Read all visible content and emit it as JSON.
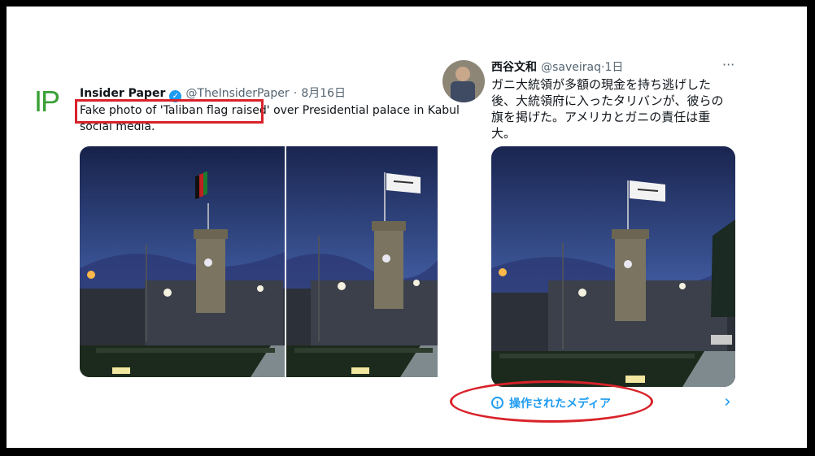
{
  "left_tweet": {
    "avatar_text": "IP",
    "author_name": "Insider Paper",
    "handle": "@TheInsiderPaper",
    "separator": "·",
    "date": "8月16日",
    "text_line1_highlight": "Fake photo of 'Taliban flag raised'",
    "text_line1_rest": " over Presidential palace in Kabul",
    "text_line2": "social media."
  },
  "right_tweet": {
    "author_name": "西谷文和",
    "handle": "@saveiraq",
    "separator": "·",
    "time": "1日",
    "more_label": "···",
    "text_lines": [
      "ガニ大統領が多額の現金を持ち逃げした",
      "後、大統領府に入ったタリバンが、彼らの",
      "旗を掲げた。アメリカとガニの責任は重",
      "大。"
    ],
    "manipulated_label": "操作されたメディア",
    "chevron": "›",
    "info_glyph": "!"
  },
  "colors": {
    "highlight": "#d9222a",
    "link_blue": "#1d9bf0",
    "verified": "#1d9bf0",
    "sky_dark": "#1e2a55",
    "sky_light": "#4d6aa8",
    "avatar_green": "#3aa035"
  }
}
